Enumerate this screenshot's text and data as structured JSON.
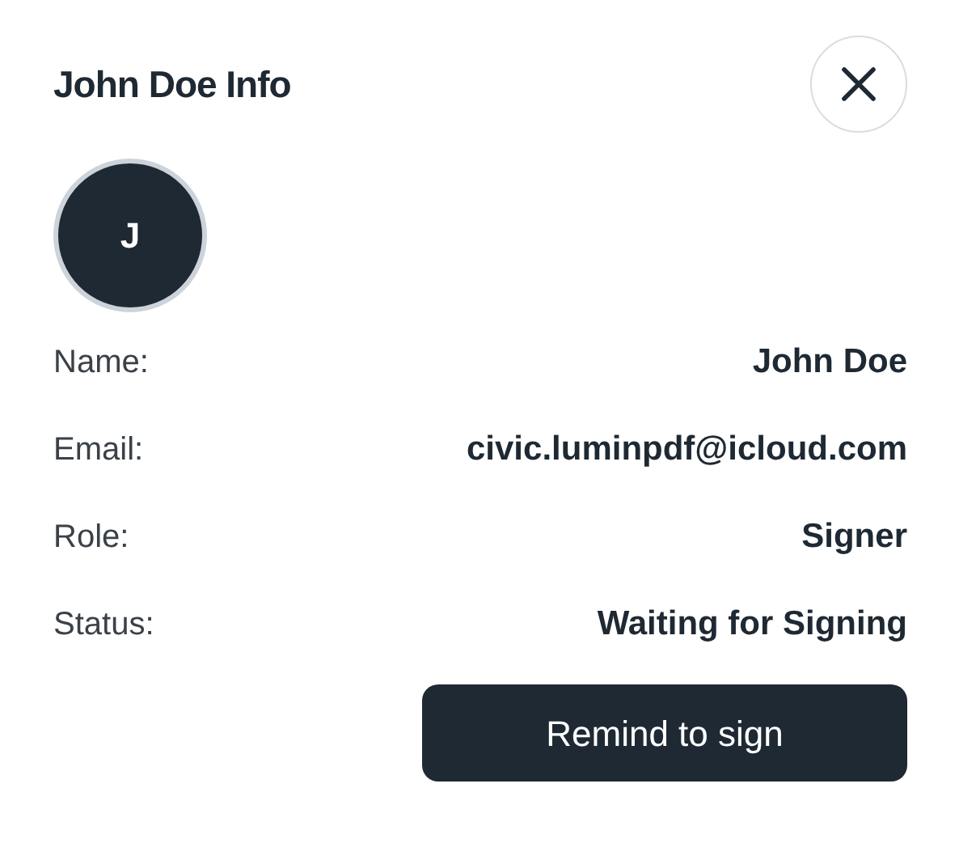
{
  "title": "John Doe Info",
  "avatar": {
    "initial": "J"
  },
  "fields": [
    {
      "label": "Name:",
      "value": "John Doe"
    },
    {
      "label": "Email:",
      "value": "civic.luminpdf@icloud.com"
    },
    {
      "label": "Role:",
      "value": "Signer"
    },
    {
      "label": "Status:",
      "value": "Waiting for Signing"
    }
  ],
  "button": "Remind to sign"
}
